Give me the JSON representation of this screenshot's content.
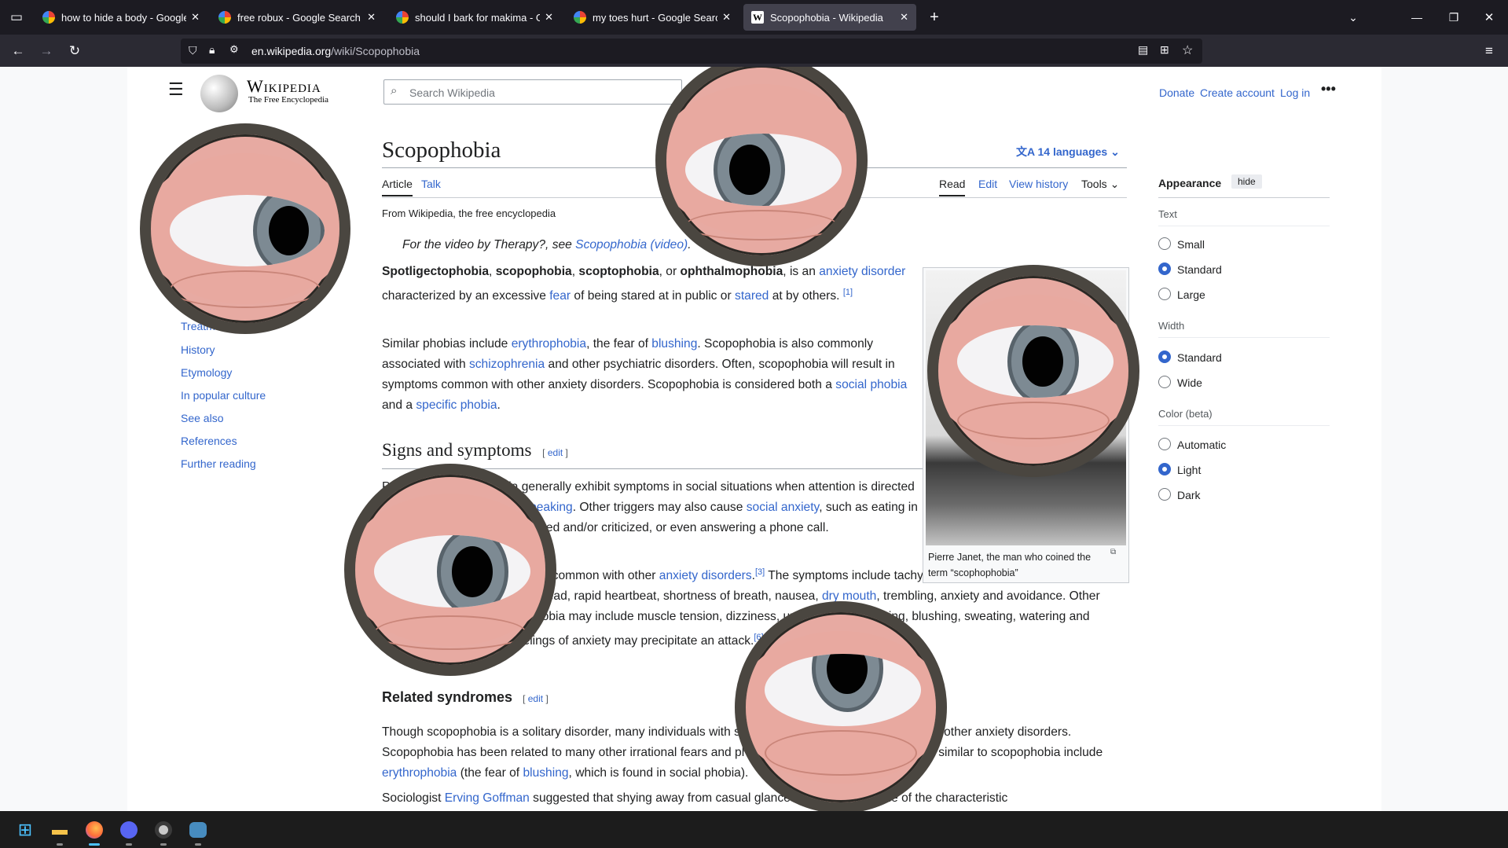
{
  "tabs": [
    {
      "title": "how to hide a body - Google Se",
      "icon": "google-icon",
      "active": false
    },
    {
      "title": "free robux - Google Search",
      "icon": "google-icon",
      "active": false
    },
    {
      "title": "should I bark for makima - Goo",
      "icon": "google-icon",
      "active": false
    },
    {
      "title": "my toes hurt - Google Search",
      "icon": "google-icon",
      "active": false
    },
    {
      "title": "Scopophobia - Wikipedia",
      "icon": "wikipedia-icon",
      "active": true
    }
  ],
  "url": {
    "domain": "en.wikipedia.org",
    "path": "/wiki/Scopophobia"
  },
  "header": {
    "logo_title": "Wikipedia",
    "logo_tagline": "The Free Encyclopedia",
    "search_placeholder": "Search Wikipedia",
    "donate": "Donate",
    "create_account": "Create account",
    "login": "Log in"
  },
  "article": {
    "title": "Scopophobia",
    "languages": "14 languages",
    "tabs": {
      "article": "Article",
      "talk": "Talk",
      "read": "Read",
      "edit": "Edit",
      "history": "View history",
      "tools": "Tools"
    },
    "from": "From Wikipedia, the free encyclopedia",
    "hatnote_pre": "For the video by Therapy?, see ",
    "hatnote_link": "Scopophobia (video)",
    "hatnote_post": ".",
    "section1": "Signs and symptoms",
    "section2": "Related syndromes",
    "edit_label": "edit",
    "caption": "Pierre Janet, the man who coined the term “scophophobia”"
  },
  "toc": [
    "Treatment",
    "History",
    "Etymology",
    "In popular culture",
    "See also",
    "References",
    "Further reading"
  ],
  "appearance": {
    "title": "Appearance",
    "hide": "hide",
    "text_label": "Text",
    "text_options": [
      "Small",
      "Standard",
      "Large"
    ],
    "width_label": "Width",
    "width_options": [
      "Standard",
      "Wide"
    ],
    "color_label": "Color (beta)",
    "color_options": [
      "Automatic",
      "Light",
      "Dark"
    ]
  },
  "colors": {
    "link": "#3366cc",
    "tab_active": "#42414d",
    "chrome": "#1c1b22",
    "toolbar": "#2b2a33"
  }
}
